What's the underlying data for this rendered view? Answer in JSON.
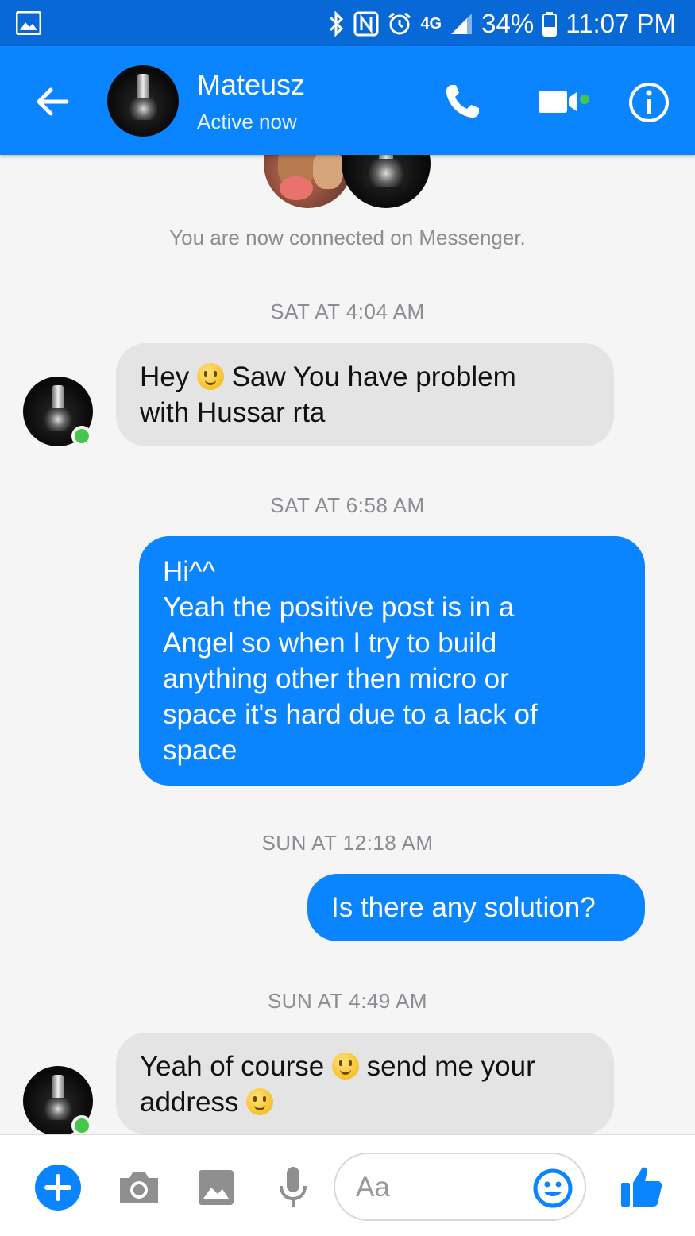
{
  "status_bar": {
    "time": "11:07 PM",
    "battery": "34%",
    "network": "4G",
    "icons": [
      "gallery-icon",
      "bluetooth-icon",
      "nfc-icon",
      "alarm-icon",
      "signal-icon",
      "battery-icon"
    ]
  },
  "header": {
    "contact_name": "Mateusz",
    "status": "Active now",
    "icons": [
      "back-arrow-icon",
      "phone-icon",
      "video-camera-icon",
      "info-icon"
    ]
  },
  "system_message": "You are now connected on Messenger.",
  "conversation": [
    {
      "type": "timestamp",
      "text": "SAT AT 4:04 AM"
    },
    {
      "type": "incoming",
      "parts": [
        "Hey ",
        ":emoji:",
        " Saw You have problem\nwith Hussar rta"
      ]
    },
    {
      "type": "timestamp",
      "text": "SAT AT 6:58 AM"
    },
    {
      "type": "outgoing",
      "text": "Hi^^\nYeah the positive post is in a\nAngel so when I try to build\nanything other then micro or\nspace it's hard due to a lack of\nspace"
    },
    {
      "type": "timestamp",
      "text": "SUN AT 12:18 AM"
    },
    {
      "type": "outgoing",
      "text": "Is there any solution?"
    },
    {
      "type": "timestamp",
      "text": "SUN AT 4:49 AM"
    },
    {
      "type": "incoming",
      "parts": [
        "Yeah of course ",
        ":emoji:",
        " send me your\naddress ",
        ":emoji:"
      ]
    }
  ],
  "messages": {
    "m1_a": "Hey ",
    "m1_b": " Saw You have problem\nwith Hussar rta",
    "m2": "Hi^^\nYeah the positive post is in a\nAngel so when I try to build\nanything other then micro or\nspace it's hard due to a lack of\nspace",
    "m3": "Is there any solution?",
    "m4_a": "Yeah of course ",
    "m4_b": " send me your\naddress ",
    "timestamps": [
      "SAT AT 4:04 AM",
      "SAT AT 6:58 AM",
      "SUN AT 12:18 AM",
      "SUN AT 4:49 AM"
    ]
  },
  "composer": {
    "placeholder": "Aa",
    "icons": [
      "plus-icon",
      "camera-icon",
      "image-icon",
      "microphone-icon",
      "emoji-icon",
      "thumbs-up-icon"
    ]
  },
  "colors": {
    "header_blue": "#0a84ff",
    "status_bar_blue": "#0768d6",
    "incoming_bubble": "#e4e4e4",
    "outgoing_bubble": "#0a84ff",
    "online_green": "#44c74a"
  }
}
